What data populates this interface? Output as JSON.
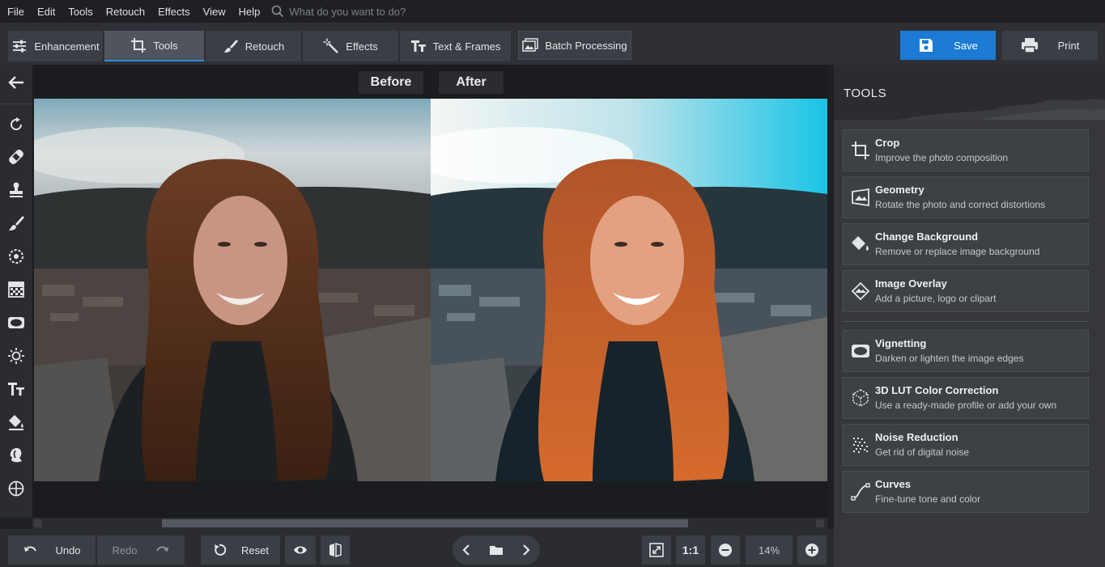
{
  "menu": {
    "items": [
      "File",
      "Edit",
      "Tools",
      "Retouch",
      "Effects",
      "View",
      "Help"
    ],
    "search_placeholder": "What do you want to do?"
  },
  "tabs": [
    {
      "label": "Enhancement",
      "icon": "sliders-icon"
    },
    {
      "label": "Tools",
      "icon": "crop-icon",
      "active": true
    },
    {
      "label": "Retouch",
      "icon": "brush-icon"
    },
    {
      "label": "Effects",
      "icon": "magic-wand-icon"
    },
    {
      "label": "Text & Frames",
      "icon": "text-icon"
    }
  ],
  "toolbar": {
    "batch_label": "Batch Processing",
    "save_label": "Save",
    "print_label": "Print"
  },
  "compare": {
    "before_label": "Before",
    "after_label": "After"
  },
  "panel": {
    "title": "TOOLS",
    "tools": [
      {
        "title": "Crop",
        "desc": "Improve the photo composition",
        "icon": "crop-icon"
      },
      {
        "title": "Geometry",
        "desc": "Rotate the photo and correct distortions",
        "icon": "geometry-icon"
      },
      {
        "title": "Change Background",
        "desc": "Remove or replace image background",
        "icon": "bucket-icon"
      },
      {
        "title": "Image Overlay",
        "desc": "Add a picture, logo or clipart",
        "icon": "overlay-icon"
      },
      {
        "title": "Vignetting",
        "desc": "Darken or lighten the image edges",
        "icon": "vignette-icon"
      },
      {
        "title": "3D LUT Color Correction",
        "desc": "Use a ready-made profile or add your own",
        "icon": "lut-cube-icon"
      },
      {
        "title": "Noise Reduction",
        "desc": "Get rid of digital noise",
        "icon": "noise-icon"
      },
      {
        "title": "Curves",
        "desc": "Fine-tune tone and color",
        "icon": "curves-icon"
      }
    ]
  },
  "bottom": {
    "undo_label": "Undo",
    "redo_label": "Redo",
    "reset_label": "Reset",
    "ratio_label": "1:1",
    "zoom_value": "14%"
  },
  "colors": {
    "accent": "#1a7ad4",
    "active_tab_underline": "#2e8be0",
    "panel_bg": "#35373c",
    "card_bg": "#3d4045"
  }
}
